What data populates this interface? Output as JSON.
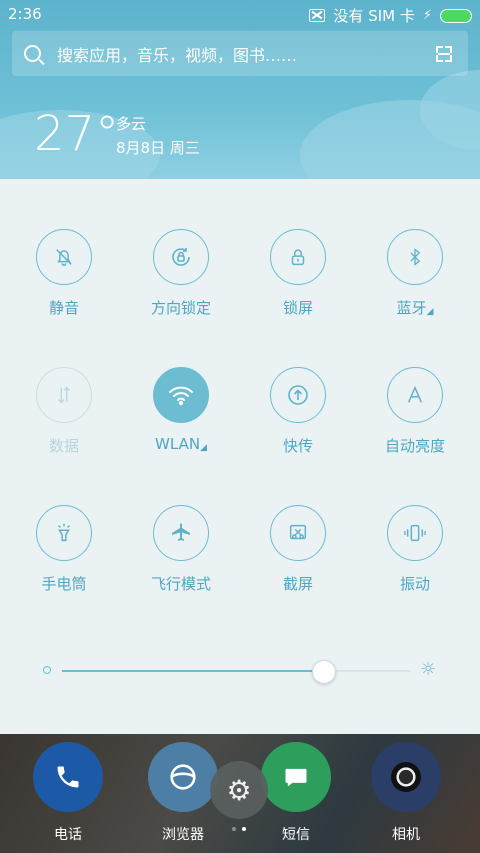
{
  "status_bar": {
    "time": "2:36",
    "sim_text": "没有 SIM 卡",
    "charging_icon": "bolt-icon"
  },
  "search": {
    "placeholder": "搜索应用，音乐，视频，图书……"
  },
  "weather": {
    "temperature": "27°",
    "condition": "多云",
    "date": "8月8日 周三"
  },
  "tiles": [
    {
      "label": "静音",
      "icon": "bell-off-icon",
      "state": "off"
    },
    {
      "label": "方向锁定",
      "icon": "rotation-lock-icon",
      "state": "off"
    },
    {
      "label": "锁屏",
      "icon": "lock-icon",
      "state": "off"
    },
    {
      "label": "蓝牙",
      "icon": "bluetooth-icon",
      "state": "off",
      "expandable": true
    },
    {
      "label": "数据",
      "icon": "data-icon",
      "state": "disabled"
    },
    {
      "label": "WLAN",
      "icon": "wifi-icon",
      "state": "on",
      "expandable": true
    },
    {
      "label": "快传",
      "icon": "transfer-icon",
      "state": "off"
    },
    {
      "label": "自动亮度",
      "icon": "auto-brightness-icon",
      "state": "off"
    },
    {
      "label": "手电筒",
      "icon": "flashlight-icon",
      "state": "off"
    },
    {
      "label": "飞行模式",
      "icon": "airplane-icon",
      "state": "off"
    },
    {
      "label": "截屏",
      "icon": "screenshot-icon",
      "state": "off"
    },
    {
      "label": "振动",
      "icon": "vibrate-icon",
      "state": "off"
    }
  ],
  "brightness": {
    "level": 0.75
  },
  "dock": [
    {
      "label": "电话",
      "icon": "phone-icon",
      "color": "#1c5aa8"
    },
    {
      "label": "浏览器",
      "icon": "browser-icon",
      "color": "#4d7fa6"
    },
    {
      "label": "短信",
      "icon": "message-icon",
      "color": "#2e9e5d"
    },
    {
      "label": "相机",
      "icon": "camera-icon",
      "color": "#2b3e68"
    }
  ],
  "colors": {
    "accent": "#6cbdd2",
    "header_bg": "#5db3cc",
    "panel_bg": "#eaf2f4"
  }
}
